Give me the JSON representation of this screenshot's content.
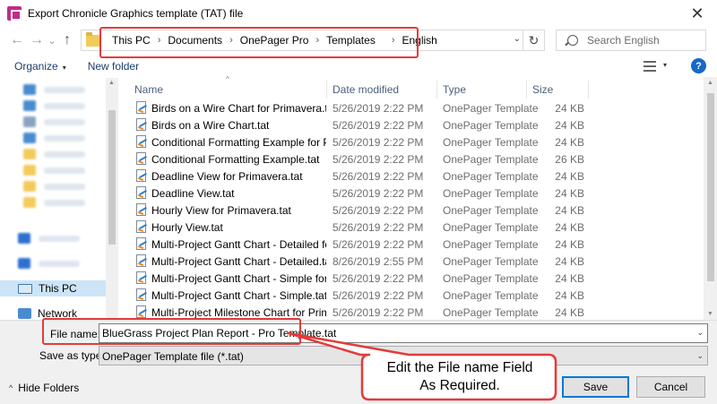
{
  "window": {
    "title": "Export Chronicle Graphics template (TAT) file",
    "close_glyph": "✕"
  },
  "nav": {
    "back_glyph": "←",
    "forward_glyph": "→",
    "recent_glyph": "⌄",
    "up_glyph": "↑",
    "breadcrumbs": [
      "This PC",
      "Documents",
      "OnePager Pro",
      "Templates",
      "English"
    ],
    "sep_glyph": "›",
    "dropdown_glyph": "⌄",
    "refresh_glyph": "↻"
  },
  "search": {
    "placeholder": "Search English"
  },
  "toolbar": {
    "organize_label": "Organize",
    "organize_caret": "▾",
    "new_folder_label": "New folder",
    "view_caret": "▾",
    "help_glyph": "?"
  },
  "sidebar": {
    "this_pc_label": "This PC",
    "network_label": "Network"
  },
  "columns": {
    "name": "Name",
    "date": "Date modified",
    "type": "Type",
    "size": "Size",
    "sort_glyph": "^"
  },
  "files": [
    {
      "name": "Birds on a Wire Chart for Primavera.tat",
      "date": "5/26/2019 2:22 PM",
      "type": "OnePager Template",
      "size": "24 KB"
    },
    {
      "name": "Birds on a Wire Chart.tat",
      "date": "5/26/2019 2:22 PM",
      "type": "OnePager Template",
      "size": "24 KB"
    },
    {
      "name": "Conditional Formatting Example for Pri...",
      "date": "5/26/2019 2:22 PM",
      "type": "OnePager Template",
      "size": "24 KB"
    },
    {
      "name": "Conditional Formatting Example.tat",
      "date": "5/26/2019 2:22 PM",
      "type": "OnePager Template",
      "size": "26 KB"
    },
    {
      "name": "Deadline View for Primavera.tat",
      "date": "5/26/2019 2:22 PM",
      "type": "OnePager Template",
      "size": "24 KB"
    },
    {
      "name": "Deadline View.tat",
      "date": "5/26/2019 2:22 PM",
      "type": "OnePager Template",
      "size": "24 KB"
    },
    {
      "name": "Hourly View for Primavera.tat",
      "date": "5/26/2019 2:22 PM",
      "type": "OnePager Template",
      "size": "24 KB"
    },
    {
      "name": "Hourly View.tat",
      "date": "5/26/2019 2:22 PM",
      "type": "OnePager Template",
      "size": "24 KB"
    },
    {
      "name": "Multi-Project Gantt Chart - Detailed for P...",
      "date": "5/26/2019 2:22 PM",
      "type": "OnePager Template",
      "size": "24 KB"
    },
    {
      "name": "Multi-Project Gantt Chart - Detailed.tat",
      "date": "8/26/2019 2:55 PM",
      "type": "OnePager Template",
      "size": "24 KB"
    },
    {
      "name": "Multi-Project Gantt Chart - Simple for Pri...",
      "date": "5/26/2019 2:22 PM",
      "type": "OnePager Template",
      "size": "24 KB"
    },
    {
      "name": "Multi-Project Gantt Chart - Simple.tat",
      "date": "5/26/2019 2:22 PM",
      "type": "OnePager Template",
      "size": "24 KB"
    },
    {
      "name": "Multi-Project Milestone Chart for Primav...",
      "date": "5/26/2019 2:22 PM",
      "type": "OnePager Template",
      "size": "24 KB"
    }
  ],
  "bottom": {
    "file_name_label": "File name:",
    "file_name_value": "BlueGrass Project Plan Report - Pro Template.tat",
    "save_as_type_label": "Save as type:",
    "save_as_type_value": "OnePager Template file  (*.tat)",
    "dropdown_glyph": "⌄",
    "hide_folders_label": "Hide Folders",
    "hide_folders_caret": "^",
    "save_label": "Save",
    "cancel_label": "Cancel"
  },
  "callout": {
    "line1": "Edit the File name Field",
    "line2": "As Required."
  },
  "colors": {
    "annotation_red": "#e33b3b",
    "selection_blue": "#cce4f7",
    "accent_blue": "#0078d7"
  }
}
